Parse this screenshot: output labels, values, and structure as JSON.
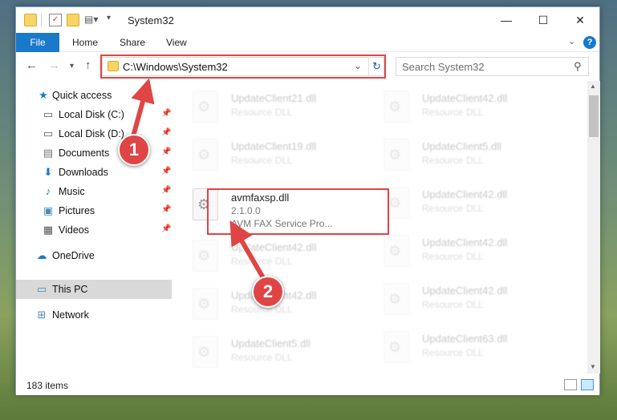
{
  "window": {
    "title": "System32",
    "controls": {
      "minimize": "—",
      "maximize": "☐",
      "close": "✕"
    }
  },
  "ribbon": {
    "tabs": [
      {
        "label": "File"
      },
      {
        "label": "Home"
      },
      {
        "label": "Share"
      },
      {
        "label": "View"
      }
    ],
    "help": "?"
  },
  "address": {
    "path": "C:\\Windows\\System32"
  },
  "search": {
    "placeholder": "Search System32"
  },
  "sidebar": {
    "items": [
      {
        "label": "Quick access",
        "icon": "star-icon"
      },
      {
        "label": "Local Disk (C:)",
        "icon": "drive-icon",
        "pinned": true
      },
      {
        "label": "Local Disk (D:)",
        "icon": "drive-icon",
        "pinned": true
      },
      {
        "label": "Documents",
        "icon": "documents-icon",
        "pinned": true
      },
      {
        "label": "Downloads",
        "icon": "download-icon",
        "pinned": true
      },
      {
        "label": "Music",
        "icon": "music-icon",
        "pinned": true
      },
      {
        "label": "Pictures",
        "icon": "pictures-icon",
        "pinned": true
      },
      {
        "label": "Videos",
        "icon": "videos-icon",
        "pinned": true
      },
      {
        "label": "OneDrive",
        "icon": "cloud-icon"
      },
      {
        "label": "This PC",
        "icon": "computer-icon",
        "selected": true
      },
      {
        "label": "Network",
        "icon": "network-icon"
      }
    ]
  },
  "files": {
    "left": [
      {
        "name": "UpdateClient21.dll",
        "desc": "Resource DLL"
      },
      {
        "name": "UpdateClient19.dll",
        "desc": "Resource DLL"
      },
      {
        "name": "avmfaxsp.dll",
        "version": "2.1.0.0",
        "desc": "AVM FAX Service Pro..."
      },
      {
        "name": "UpdateClient42.dll",
        "desc": "Resource DLL"
      },
      {
        "name": "UpdateClient42.dll",
        "desc": "Resource DLL"
      },
      {
        "name": "UpdateClient5.dll",
        "desc": "Resource DLL"
      }
    ],
    "right": [
      {
        "name": "UpdateClient42.dll",
        "desc": "Resource DLL"
      },
      {
        "name": "UpdateClient5.dll",
        "desc": "Resource DLL"
      },
      {
        "name": "UpdateClient42.dll",
        "desc": "Resource DLL"
      },
      {
        "name": "UpdateClient42.dll",
        "desc": "Resource DLL"
      },
      {
        "name": "UpdateClient42.dll",
        "desc": "Resource DLL"
      },
      {
        "name": "UpdateClient63.dll",
        "desc": "Resource DLL"
      }
    ]
  },
  "status": {
    "item_count": "183 items"
  },
  "annotations": {
    "step1": "1",
    "step2": "2"
  },
  "colors": {
    "accent": "#1979ca",
    "highlight": "#e04545",
    "selection": "#cce8ff"
  }
}
